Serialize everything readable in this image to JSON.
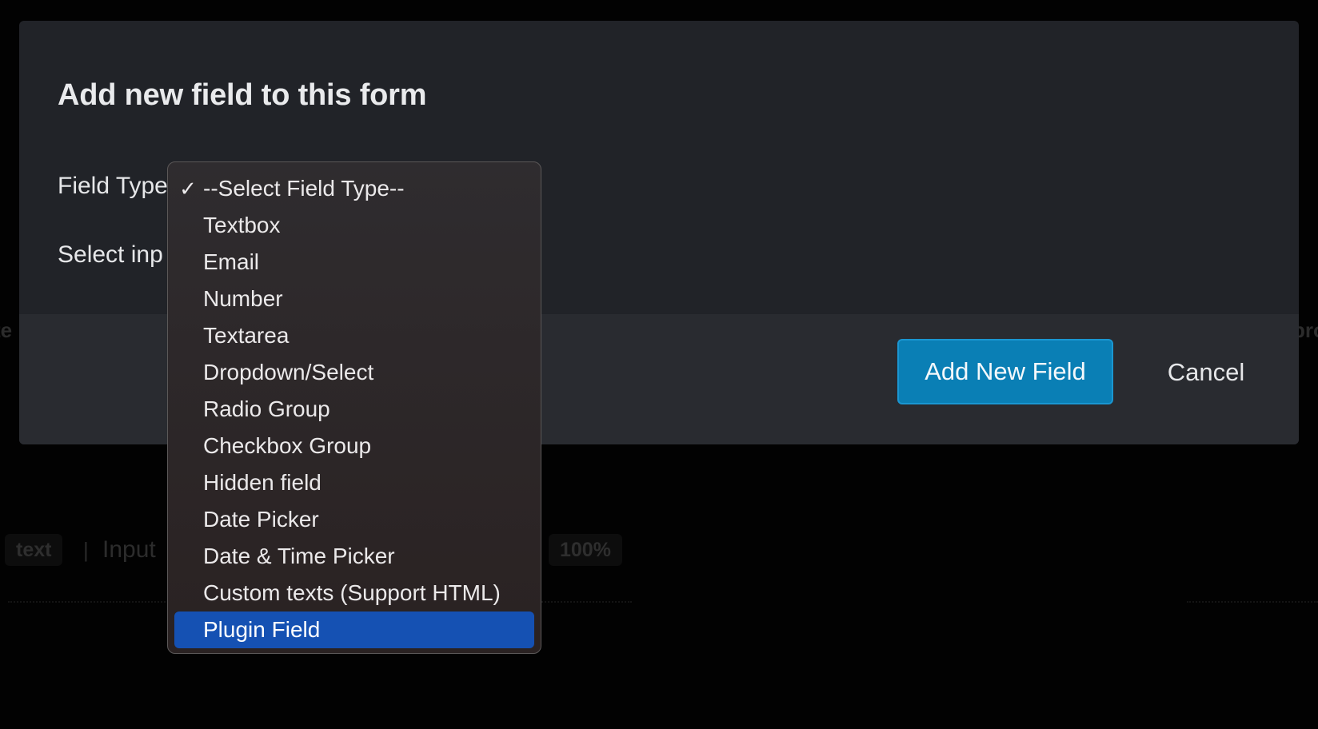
{
  "modal": {
    "title": "Add new field to this form",
    "field_type_label": "Field Type",
    "select_input_label": "Select inp",
    "add_button_label": "Add New Field",
    "cancel_button_label": "Cancel"
  },
  "dropdown": {
    "selected_check": "✓",
    "highlighted_index": 12,
    "options": [
      "--Select Field Type--",
      "Textbox",
      "Email",
      "Number",
      "Textarea",
      "Dropdown/Select",
      "Radio Group",
      "Checkbox Group",
      "Hidden field",
      "Date Picker",
      "Date & Time Picker",
      "Custom texts (Support HTML)",
      "Plugin Field"
    ]
  },
  "background": {
    "left_fragment": "te",
    "right_fragment": "pro",
    "chip_text": "text",
    "separator": "|",
    "input_text": "Input",
    "percent_text": "100%"
  },
  "colors": {
    "modal_bg": "#212328",
    "footer_bg": "#292b30",
    "primary_button": "#0a7fb5",
    "highlight": "#1551b3"
  }
}
